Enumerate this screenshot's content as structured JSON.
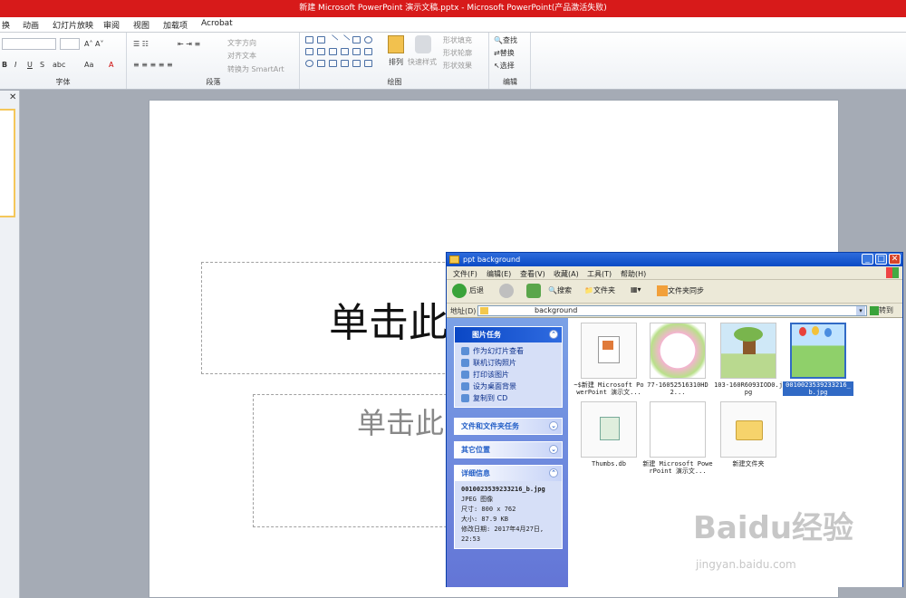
{
  "window_title": "新建 Microsoft PowerPoint 演示文稿.pptx  -  Microsoft PowerPoint(产品激活失败)",
  "menu_tabs": [
    "换",
    "动画",
    "幻灯片放映",
    "审阅",
    "视图",
    "加载项",
    "Acrobat"
  ],
  "ribbon": {
    "groups": [
      "字体",
      "段落",
      "绘图",
      "编辑"
    ],
    "paragraph": {
      "text_dir": "文字方向",
      "align_text": "对齐文本",
      "to_smartart": "转换为 SmartArt"
    },
    "drawing": {
      "arrange": "排列",
      "quick_styles": "快速样式",
      "shape_fill": "形状填充",
      "shape_outline": "形状轮廓",
      "shape_effects": "形状效果"
    },
    "editing": {
      "find": "查找",
      "replace": "替换",
      "select": "选择"
    }
  },
  "slide": {
    "title_placeholder": "单击此",
    "subtitle_placeholder": "单击此"
  },
  "explorer": {
    "title": "ppt background",
    "menu": [
      "文件(F)",
      "编辑(E)",
      "查看(V)",
      "收藏(A)",
      "工具(T)",
      "帮助(H)"
    ],
    "toolbar": {
      "back": "后退",
      "search": "搜索",
      "folders": "文件夹",
      "sync": "文件夹同步"
    },
    "address_label": "地址(D)",
    "address_value": "background",
    "go": "转到",
    "picture_tasks": {
      "title": "图片任务",
      "items": [
        "作为幻灯片查看",
        "联机订购照片",
        "打印该图片",
        "设为桌面背景",
        "复制到 CD"
      ]
    },
    "file_folder_tasks": "文件和文件夹任务",
    "other_places": "其它位置",
    "details": {
      "title": "详细信息",
      "filename": "0010023539233216_b.jpg",
      "type": "JPEG 图像",
      "size_dim": "尺寸: 800 x 762",
      "filesize": "大小: 87.9 KB",
      "modified": "修改日期: 2017年4月27日, 22:53"
    },
    "files": [
      {
        "name": "~$新建 Microsoft PowerPoint 演示文...",
        "kind": "ppt"
      },
      {
        "name": "77-16052516310HD2...",
        "kind": "image-frame"
      },
      {
        "name": "103-160R6093IOD0.jpg",
        "kind": "image-tree"
      },
      {
        "name": "0010023539233216_b.jpg",
        "kind": "image-kids",
        "selected": true
      },
      {
        "name": "Thumbs.db",
        "kind": "db"
      },
      {
        "name": "新建 Microsoft PowerPoint 演示文...",
        "kind": "ppt-blank"
      },
      {
        "name": "新建文件夹",
        "kind": "folder"
      }
    ]
  },
  "watermark": {
    "brand": "Baidu经验",
    "url": "jingyan.baidu.com"
  }
}
